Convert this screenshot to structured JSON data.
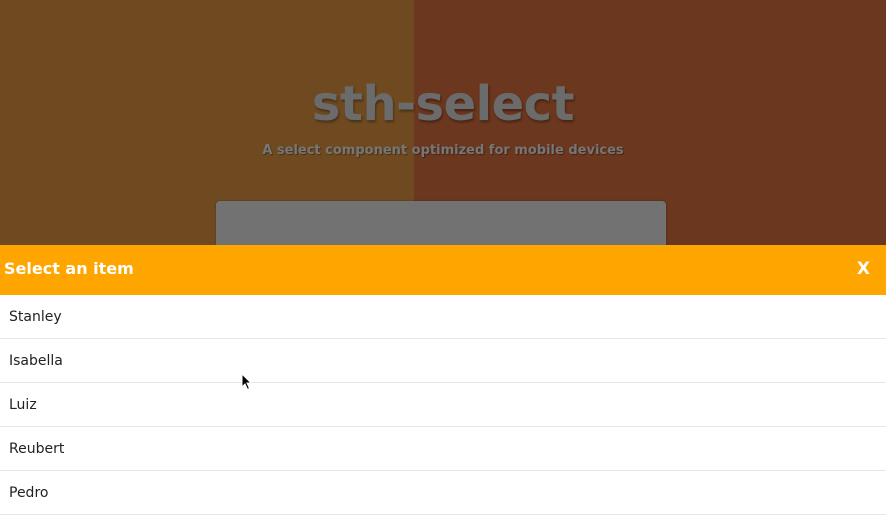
{
  "hero": {
    "title": "sth-select",
    "subtitle": "A select component optimized for mobile devices"
  },
  "modal": {
    "title": "Select an item",
    "close_label": "X",
    "items": [
      "Stanley",
      "Isabella",
      "Luiz",
      "Reubert",
      "Pedro"
    ]
  },
  "colors": {
    "header": "#ffa500",
    "overlay_left": "#6f4a20",
    "overlay_right": "#6b371e"
  }
}
